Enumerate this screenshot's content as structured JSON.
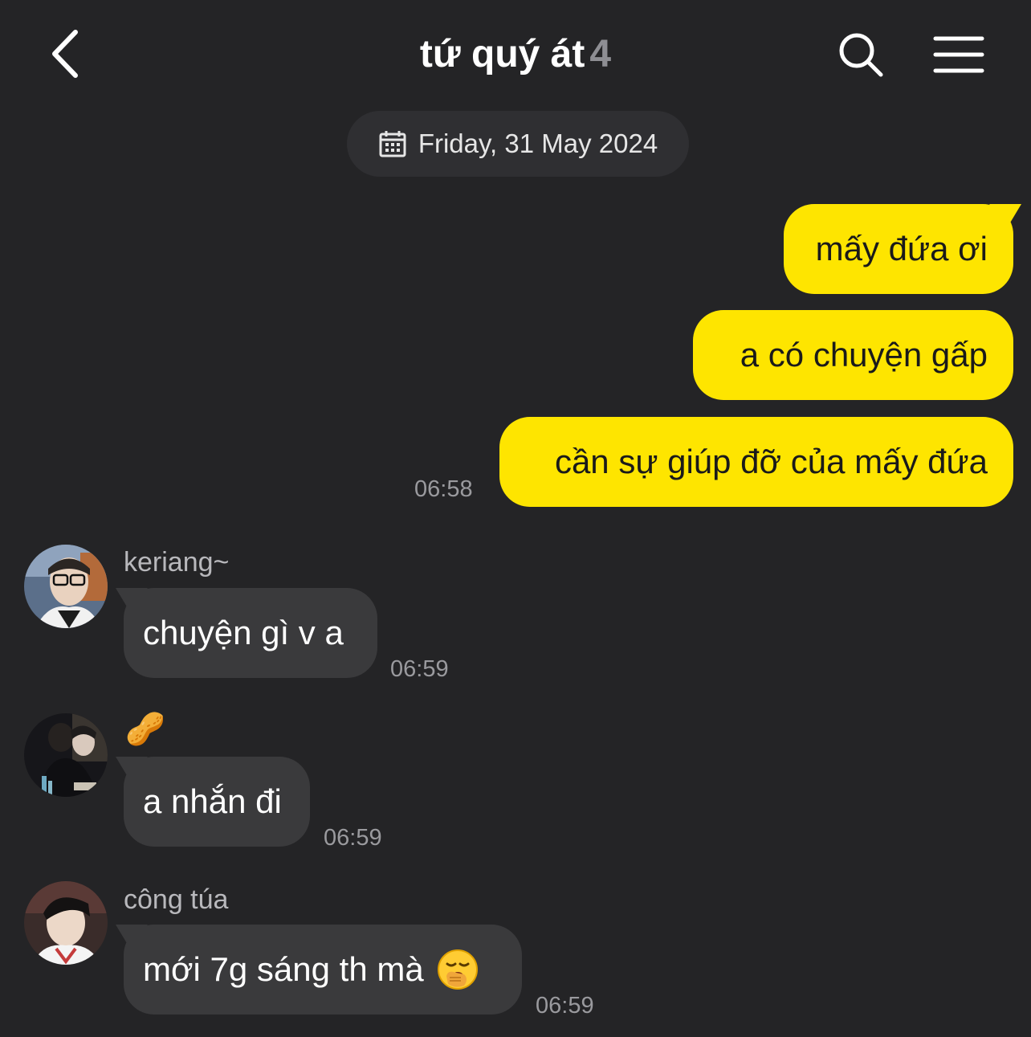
{
  "header": {
    "title": "tứ quý át",
    "member_count": "4",
    "back_icon": "chevron-left-icon",
    "search_icon": "search-icon",
    "menu_icon": "hamburger-menu-icon"
  },
  "date_divider": {
    "label": "Friday, 31 May 2024",
    "icon": "calendar-icon"
  },
  "messages": [
    {
      "direction": "outgoing",
      "text": "mấy đứa ơi"
    },
    {
      "direction": "outgoing",
      "text": "a có chuyện gấp"
    },
    {
      "direction": "outgoing",
      "text": "cần sự giúp đỡ của mấy đứa",
      "time": "06:58"
    },
    {
      "direction": "incoming",
      "sender": "keriang~",
      "text": "chuyện gì v a",
      "time": "06:59"
    },
    {
      "direction": "incoming",
      "sender": "🥜",
      "text": "a nhắn đi",
      "time": "06:59"
    },
    {
      "direction": "incoming",
      "sender": "công túa",
      "text": "mới 7g sáng th mà",
      "emoji": "yawning-face-emoji",
      "time": "06:59"
    }
  ],
  "colors": {
    "background": "#242426",
    "outgoing_bubble": "#fee500",
    "incoming_bubble": "#3a3a3c",
    "muted_text": "#9a9a9e"
  }
}
